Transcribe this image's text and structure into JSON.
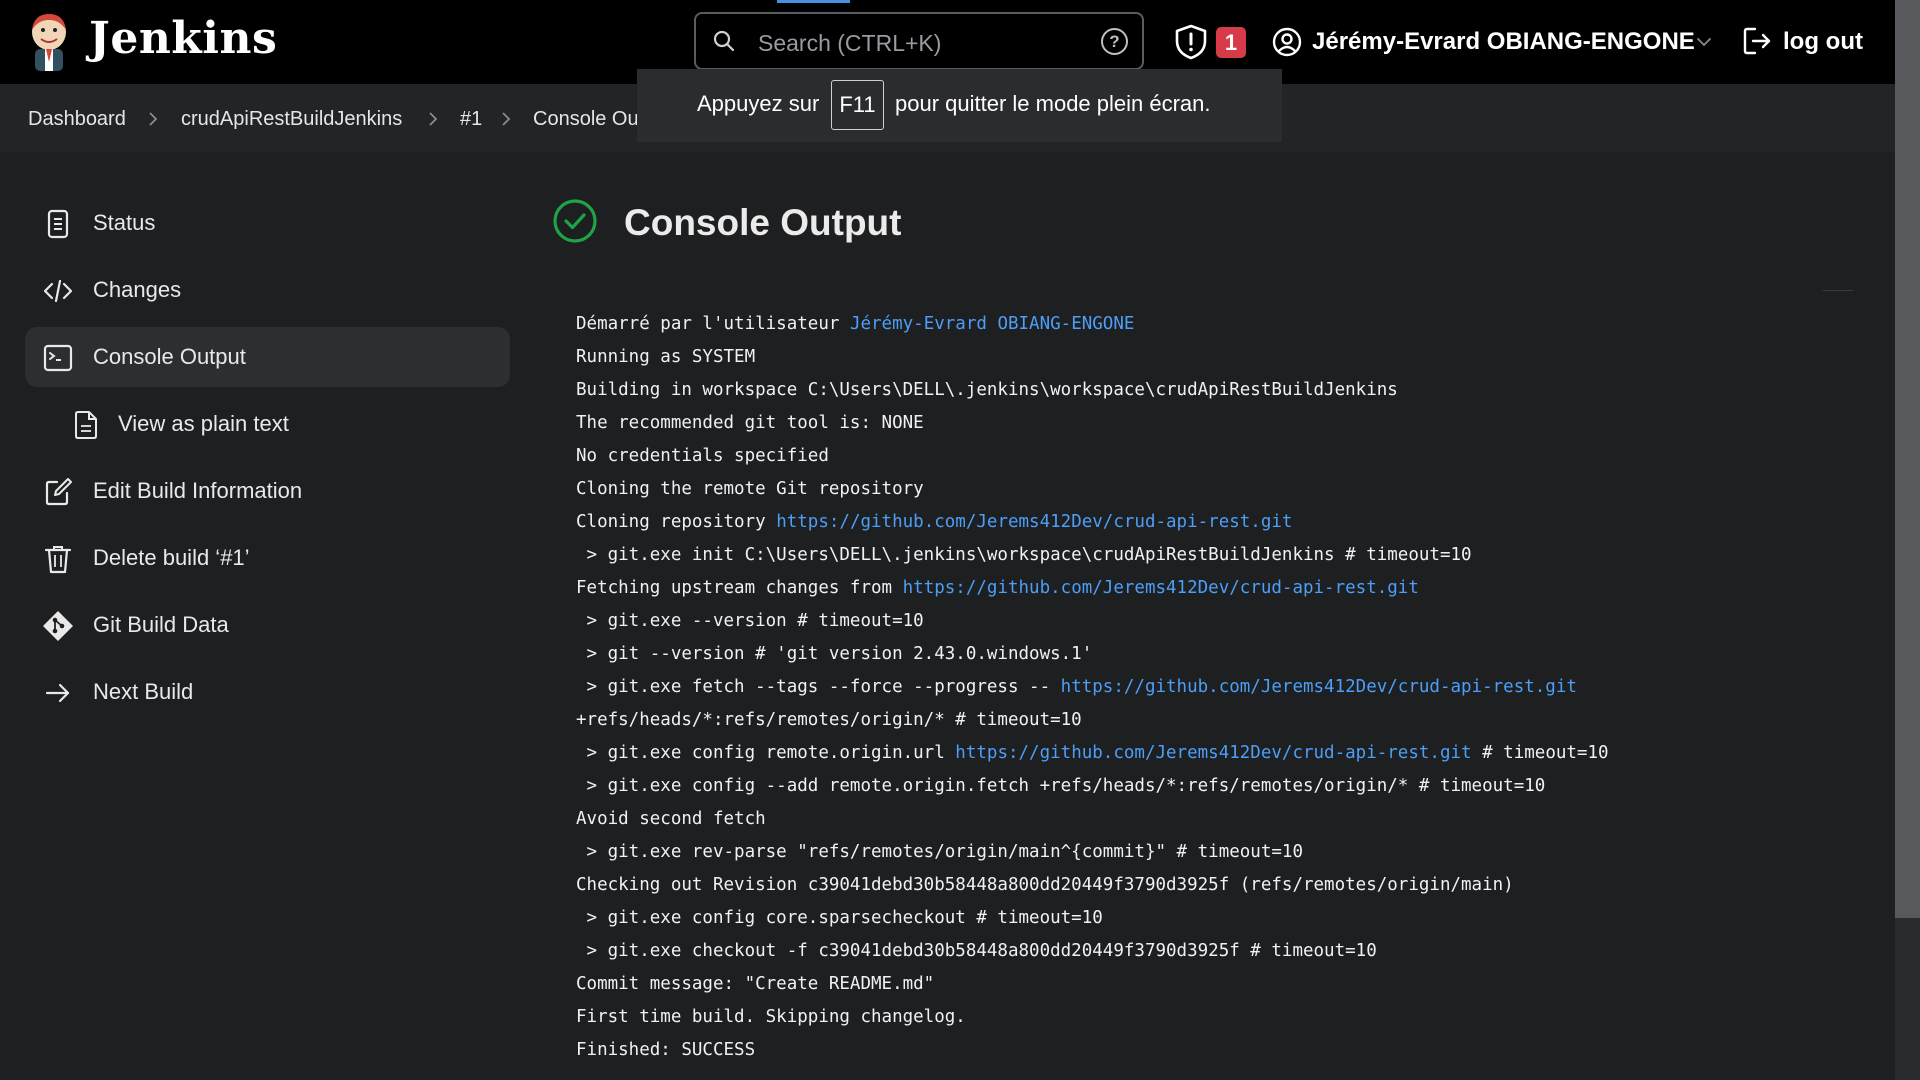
{
  "header": {
    "brand": "Jenkins",
    "search_placeholder": "Search (CTRL+K)",
    "help_glyph": "?",
    "security_alert_count": "1",
    "user_name": "Jérémy-Evrard OBIANG-ENGONE",
    "logout_label": "log out",
    "accent_color": "#4a90e2",
    "alert_color": "#d73a49"
  },
  "fullscreen_notice": {
    "before": "Appuyez sur",
    "key": "F11",
    "after": "pour quitter le mode plein écran."
  },
  "breadcrumbs": [
    "Dashboard",
    "crudApiRestBuildJenkins",
    "#1",
    "Console Output"
  ],
  "sidebar": {
    "items": [
      {
        "label": "Status",
        "icon": "document-icon"
      },
      {
        "label": "Changes",
        "icon": "code-icon"
      },
      {
        "label": "Console Output",
        "icon": "terminal-icon",
        "active": true
      },
      {
        "label": "View as plain text",
        "icon": "file-text-icon"
      },
      {
        "label": "Edit Build Information",
        "icon": "edit-icon"
      },
      {
        "label": "Delete build ‘#1’",
        "icon": "trash-icon"
      },
      {
        "label": "Git Build Data",
        "icon": "git-icon"
      },
      {
        "label": "Next Build",
        "icon": "arrow-right-icon"
      }
    ]
  },
  "main": {
    "title": "Console Output",
    "status_color": "#1ea446"
  },
  "console": {
    "link_color": "#4d9ef6",
    "lines": [
      {
        "text": "Démarré par l'utilisateur ",
        "link": "Jérémy-Evrard OBIANG-ENGONE",
        "after": ""
      },
      {
        "text": "Running as SYSTEM"
      },
      {
        "text": "Building in workspace C:\\Users\\DELL\\.jenkins\\workspace\\crudApiRestBuildJenkins"
      },
      {
        "text": "The recommended git tool is: NONE"
      },
      {
        "text": "No credentials specified"
      },
      {
        "text": "Cloning the remote Git repository"
      },
      {
        "text": "Cloning repository ",
        "link": "https://github.com/Jerems412Dev/crud-api-rest.git",
        "after": ""
      },
      {
        "text": " > git.exe init C:\\Users\\DELL\\.jenkins\\workspace\\crudApiRestBuildJenkins # timeout=10"
      },
      {
        "text": "Fetching upstream changes from ",
        "link": "https://github.com/Jerems412Dev/crud-api-rest.git",
        "after": ""
      },
      {
        "text": " > git.exe --version # timeout=10"
      },
      {
        "text": " > git --version # 'git version 2.43.0.windows.1'"
      },
      {
        "text": " > git.exe fetch --tags --force --progress -- ",
        "link": "https://github.com/Jerems412Dev/crud-api-rest.git",
        "after": ""
      },
      {
        "text": "+refs/heads/*:refs/remotes/origin/* # timeout=10"
      },
      {
        "text": " > git.exe config remote.origin.url ",
        "link": "https://github.com/Jerems412Dev/crud-api-rest.git",
        "after": " # timeout=10"
      },
      {
        "text": " > git.exe config --add remote.origin.fetch +refs/heads/*:refs/remotes/origin/* # timeout=10"
      },
      {
        "text": "Avoid second fetch"
      },
      {
        "text": " > git.exe rev-parse \"refs/remotes/origin/main^{commit}\" # timeout=10"
      },
      {
        "text": "Checking out Revision c39041debd30b58448a800dd20449f3790d3925f (refs/remotes/origin/main)"
      },
      {
        "text": " > git.exe config core.sparsecheckout # timeout=10"
      },
      {
        "text": " > git.exe checkout -f c39041debd30b58448a800dd20449f3790d3925f # timeout=10"
      },
      {
        "text": "Commit message: \"Create README.md\""
      },
      {
        "text": "First time build. Skipping changelog."
      },
      {
        "text": "Finished: SUCCESS"
      }
    ]
  }
}
